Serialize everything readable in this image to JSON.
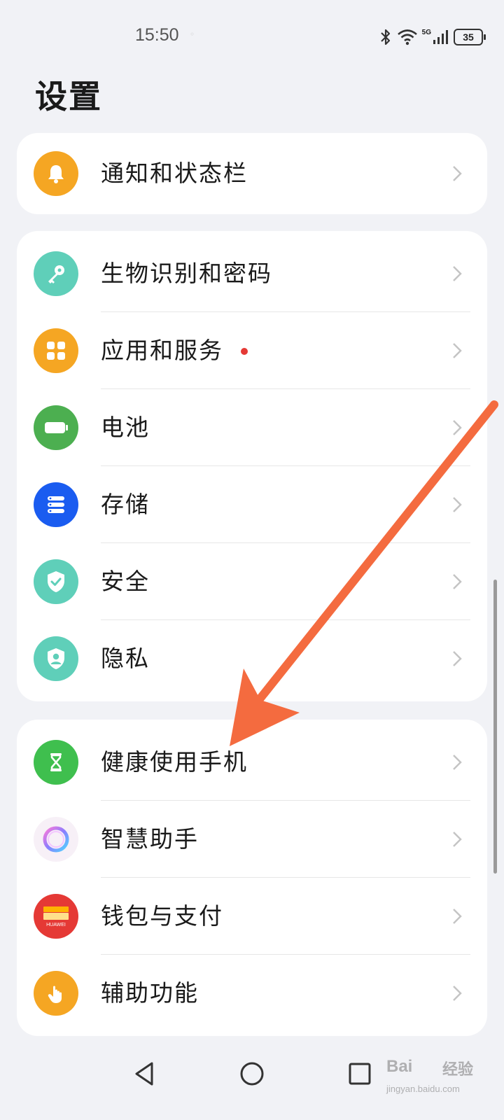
{
  "status_bar": {
    "time": "15:50",
    "network": "5G",
    "battery": "35",
    "icons": [
      "bluetooth-icon",
      "wifi-icon",
      "signal-icon",
      "battery-icon"
    ]
  },
  "page": {
    "title": "设置"
  },
  "groups": [
    {
      "items": [
        {
          "label": "通知和状态栏",
          "icon": "bell-icon",
          "color": "#f5a623"
        }
      ]
    },
    {
      "items": [
        {
          "label": "生物识别和密码",
          "icon": "key-icon",
          "color": "#5fcfb9"
        },
        {
          "label": "应用和服务",
          "icon": "apps-icon",
          "color": "#f5a623",
          "badge_color": "#e53935"
        },
        {
          "label": "电池",
          "icon": "battery-icon",
          "color": "#4caf50"
        },
        {
          "label": "存储",
          "icon": "storage-icon",
          "color": "#1a5cf0"
        },
        {
          "label": "安全",
          "icon": "shield-check-icon",
          "color": "#5fcfb9"
        },
        {
          "label": "隐私",
          "icon": "privacy-icon",
          "color": "#5fcfb9"
        }
      ]
    },
    {
      "items": [
        {
          "label": "健康使用手机",
          "icon": "hourglass-icon",
          "color": "#3fbf4e"
        },
        {
          "label": "智慧助手",
          "icon": "assistant-icon",
          "color": "#f7f0f7"
        },
        {
          "label": "钱包与支付",
          "icon": "wallet-icon",
          "color": "#e53935",
          "icon_text": "HUAWEI"
        },
        {
          "label": "辅助功能",
          "icon": "accessibility-icon",
          "color": "#f5a623"
        }
      ]
    }
  ],
  "annotation": {
    "color": "#f46b3f"
  },
  "nav_bar": {
    "icons": [
      "back-icon",
      "home-icon",
      "recents-icon"
    ]
  },
  "watermark": {
    "brand": "Bai",
    "brand2": "经验",
    "sub": "jingyan.baidu.com"
  }
}
